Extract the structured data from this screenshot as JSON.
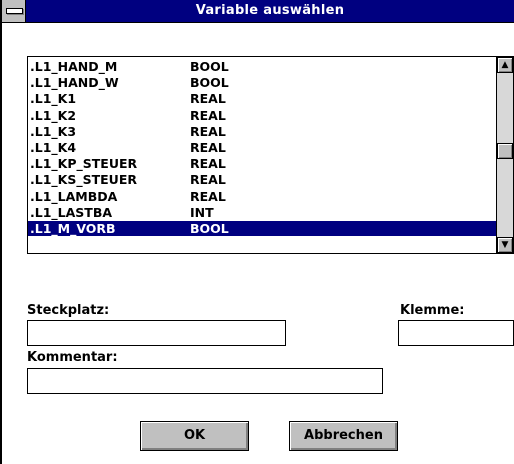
{
  "window": {
    "title": "Variable auswählen"
  },
  "list": {
    "items": [
      {
        "name": ".L1_HAND_M",
        "type": "BOOL"
      },
      {
        "name": ".L1_HAND_W",
        "type": "BOOL"
      },
      {
        "name": ".L1_K1",
        "type": "REAL"
      },
      {
        "name": ".L1_K2",
        "type": "REAL"
      },
      {
        "name": ".L1_K3",
        "type": "REAL"
      },
      {
        "name": ".L1_K4",
        "type": "REAL"
      },
      {
        "name": ".L1_KP_STEUER",
        "type": "REAL"
      },
      {
        "name": ".L1_KS_STEUER",
        "type": "REAL"
      },
      {
        "name": ".L1_LAMBDA",
        "type": "REAL"
      },
      {
        "name": ".L1_LASTBA",
        "type": "INT"
      },
      {
        "name": ".L1_M_VORB",
        "type": "BOOL"
      }
    ],
    "selected_index": 10,
    "scroll_up_glyph": "▲",
    "scroll_down_glyph": "▼"
  },
  "form": {
    "steckplatz_label": "Steckplatz:",
    "steckplatz_value": "",
    "klemme_label": "Klemme:",
    "klemme_value": "",
    "kommentar_label": "Kommentar:",
    "kommentar_value": ""
  },
  "buttons": {
    "ok": "OK",
    "cancel": "Abbrechen"
  },
  "colors": {
    "titlebar": "#000080",
    "selection": "#000080",
    "face": "#c0c0c0"
  }
}
